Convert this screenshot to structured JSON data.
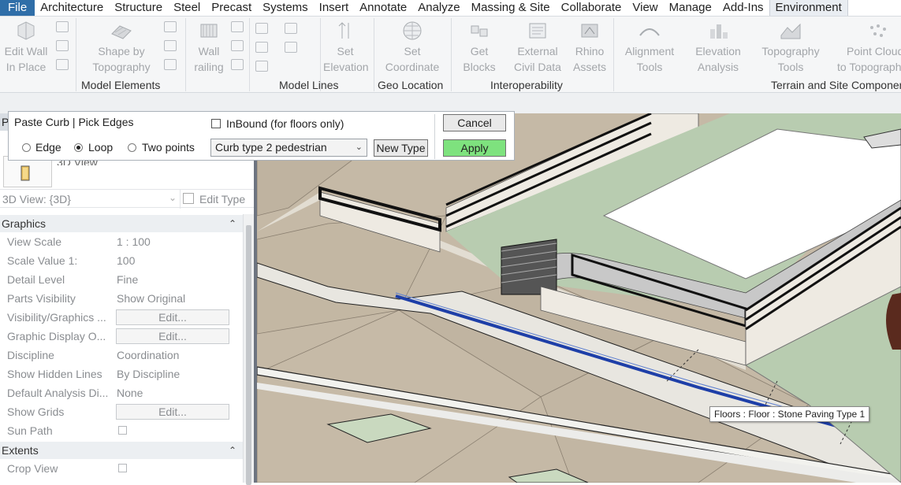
{
  "tabs": [
    "File",
    "Architecture",
    "Structure",
    "Steel",
    "Precast",
    "Systems",
    "Insert",
    "Annotate",
    "Analyze",
    "Massing & Site",
    "Collaborate",
    "View",
    "Manage",
    "Add-Ins",
    "Environment"
  ],
  "ribbon": {
    "edit_wall": [
      "Edit Wall",
      "In Place"
    ],
    "shape_by": [
      "Shape by",
      "Topography"
    ],
    "wall_railing": [
      "Wall",
      "railing"
    ],
    "set_elevation": [
      "Set",
      "Elevation"
    ],
    "set_coordinate": [
      "Set",
      "Coordinate"
    ],
    "get_blocks": [
      "Get",
      "Blocks"
    ],
    "external_civil": [
      "External",
      "Civil Data"
    ],
    "rhino_assets": [
      "Rhino",
      "Assets"
    ],
    "alignment_tools": [
      "Alignment",
      "Tools"
    ],
    "elevation_analysis": [
      "Elevation",
      "Analysis"
    ],
    "topography_tools": [
      "Topography",
      "Tools"
    ],
    "point_cloud": [
      "Point Cloud",
      "to Topography"
    ],
    "groups": {
      "model_elements": "Model Elements",
      "model_lines": "Model Lines",
      "geo_location": "Geo Location",
      "interoperability": "Interoperability",
      "terrain": "Terrain and Site Components"
    }
  },
  "options": {
    "title": "Paste Curb | Pick Edges",
    "inbound_label": "InBound (for floors only)",
    "radio_edge": "Edge",
    "radio_loop": "Loop",
    "radio_two_points": "Two points",
    "curb_type": "Curb type 2 pedestrian",
    "new_type": "New Type",
    "cancel": "Cancel",
    "apply": "Apply"
  },
  "properties": {
    "partial_title": "Pr",
    "view_label": "3D View",
    "view_selector": "3D View: {3D}",
    "edit_type": "Edit Type",
    "graphics_header": "Graphics",
    "rows": [
      {
        "k": "View Scale",
        "v": "1 : 100"
      },
      {
        "k": "Scale Value    1:",
        "v": "100"
      },
      {
        "k": "Detail Level",
        "v": "Fine"
      },
      {
        "k": "Parts Visibility",
        "v": "Show Original"
      },
      {
        "k": "Visibility/Graphics ...",
        "v": "Edit..."
      },
      {
        "k": "Graphic Display O...",
        "v": "Edit..."
      },
      {
        "k": "Discipline",
        "v": "Coordination"
      },
      {
        "k": "Show Hidden Lines",
        "v": "By Discipline"
      },
      {
        "k": "Default Analysis Di...",
        "v": "None"
      },
      {
        "k": "Show Grids",
        "v": "Edit..."
      },
      {
        "k": "Sun Path",
        "v": ""
      }
    ],
    "extents_header": "Extents",
    "crop_view": "Crop View"
  },
  "tooltip": "Floors : Floor : Stone Paving Type 1",
  "colors": {
    "file_tab": "#2f6ea8",
    "apply": "#7ee27e",
    "curb_line": "#1e3fa8"
  }
}
